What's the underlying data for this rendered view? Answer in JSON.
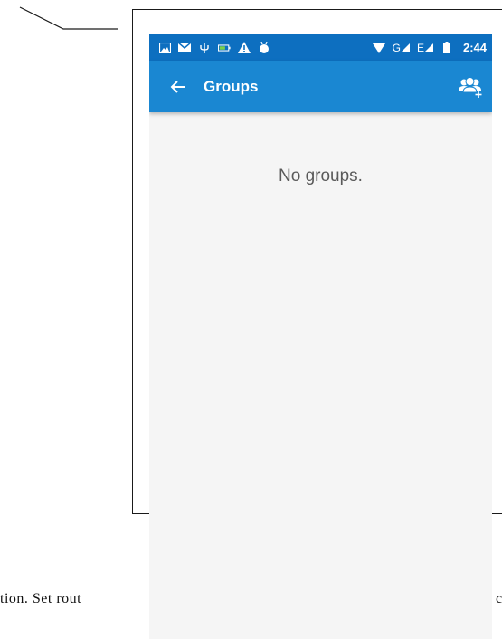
{
  "document": {
    "text_left": "tion. Set rout",
    "text_right": "c"
  },
  "status_bar": {
    "time": "2:44",
    "network_label": "G",
    "network_label_2": "E",
    "background_color": "#0d6fc0"
  },
  "app_bar": {
    "title": "Groups",
    "background_color": "#1a87d2",
    "back_icon": "arrow-left-icon",
    "action_icon": "add-group-icon"
  },
  "content": {
    "empty_message": "No groups."
  }
}
